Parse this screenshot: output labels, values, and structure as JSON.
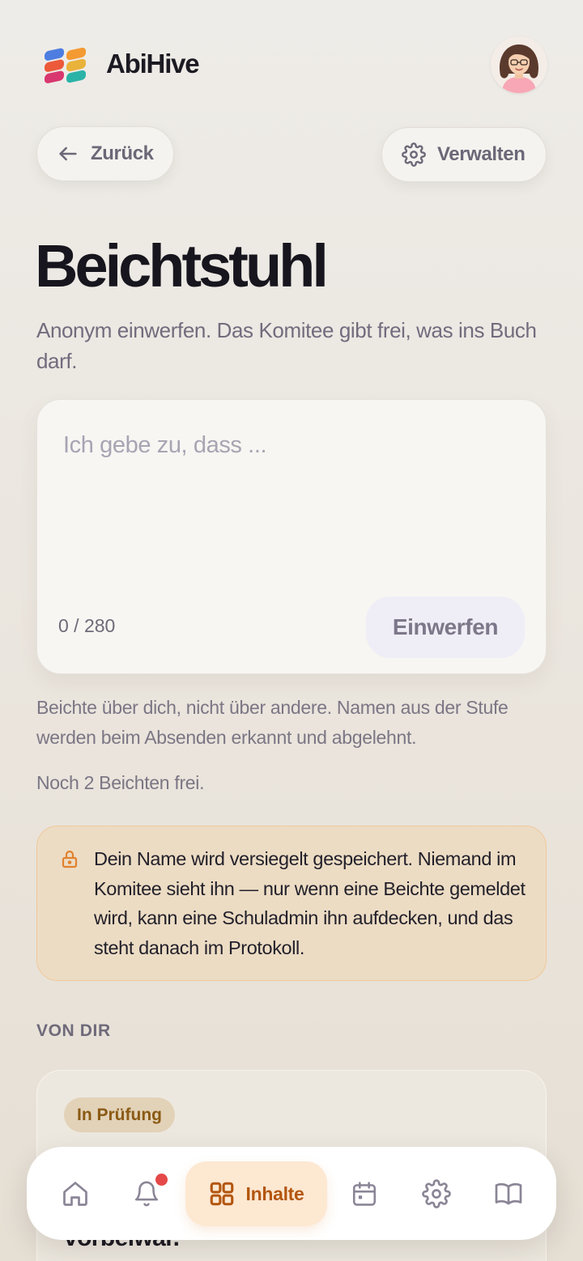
{
  "header": {
    "brand": "AbiHive",
    "logo_colors": [
      "#4d7de0",
      "#f39a32",
      "#ec5a3a",
      "#e9b23a",
      "#d8376f",
      "#2bb3a8"
    ]
  },
  "actions": {
    "back_label": "Zurück",
    "manage_label": "Verwalten"
  },
  "page": {
    "title": "Beichtstuhl",
    "subtitle": "Anonym einwerfen. Das Komitee gibt frei, was ins Buch darf."
  },
  "form": {
    "placeholder": "Ich gebe zu, dass ...",
    "value": "",
    "counter": "0 / 280",
    "submit_label": "Einwerfen"
  },
  "hint": "Beichte über dich, nicht über andere. Namen aus der Stufe werden beim Absenden erkannt und abgelehnt.",
  "remaining": "Noch 2 Beichten frei.",
  "notice": {
    "icon": "lock-icon",
    "text": "Dein Name wird versiegelt gespeichert. Niemand im Komitee sieht ihn — nur wenn eine Beichte gemeldet wird, kann eine Schuladmin ihn aufdecken, und das steht danach im Protokoll."
  },
  "own_section": {
    "label": "VON DIR",
    "entries": [
      {
        "status": "In Prüfung",
        "text_fragment": "vorbeiwar."
      }
    ]
  },
  "bottom_nav": {
    "items": [
      {
        "icon": "home-icon"
      },
      {
        "icon": "bell-icon",
        "has_notification": true
      },
      {
        "icon": "grid-icon",
        "label": "Inhalte",
        "active": true
      },
      {
        "icon": "calendar-icon"
      },
      {
        "icon": "gear-icon"
      },
      {
        "icon": "book-icon"
      }
    ]
  },
  "colors": {
    "accent": "#b3560f",
    "accent_bg": "#fde8d2",
    "notice_bg": "#ecdcc4",
    "notice_border": "#f1c99a",
    "badge_text": "#8a5a14",
    "notification_dot": "#e54848"
  }
}
